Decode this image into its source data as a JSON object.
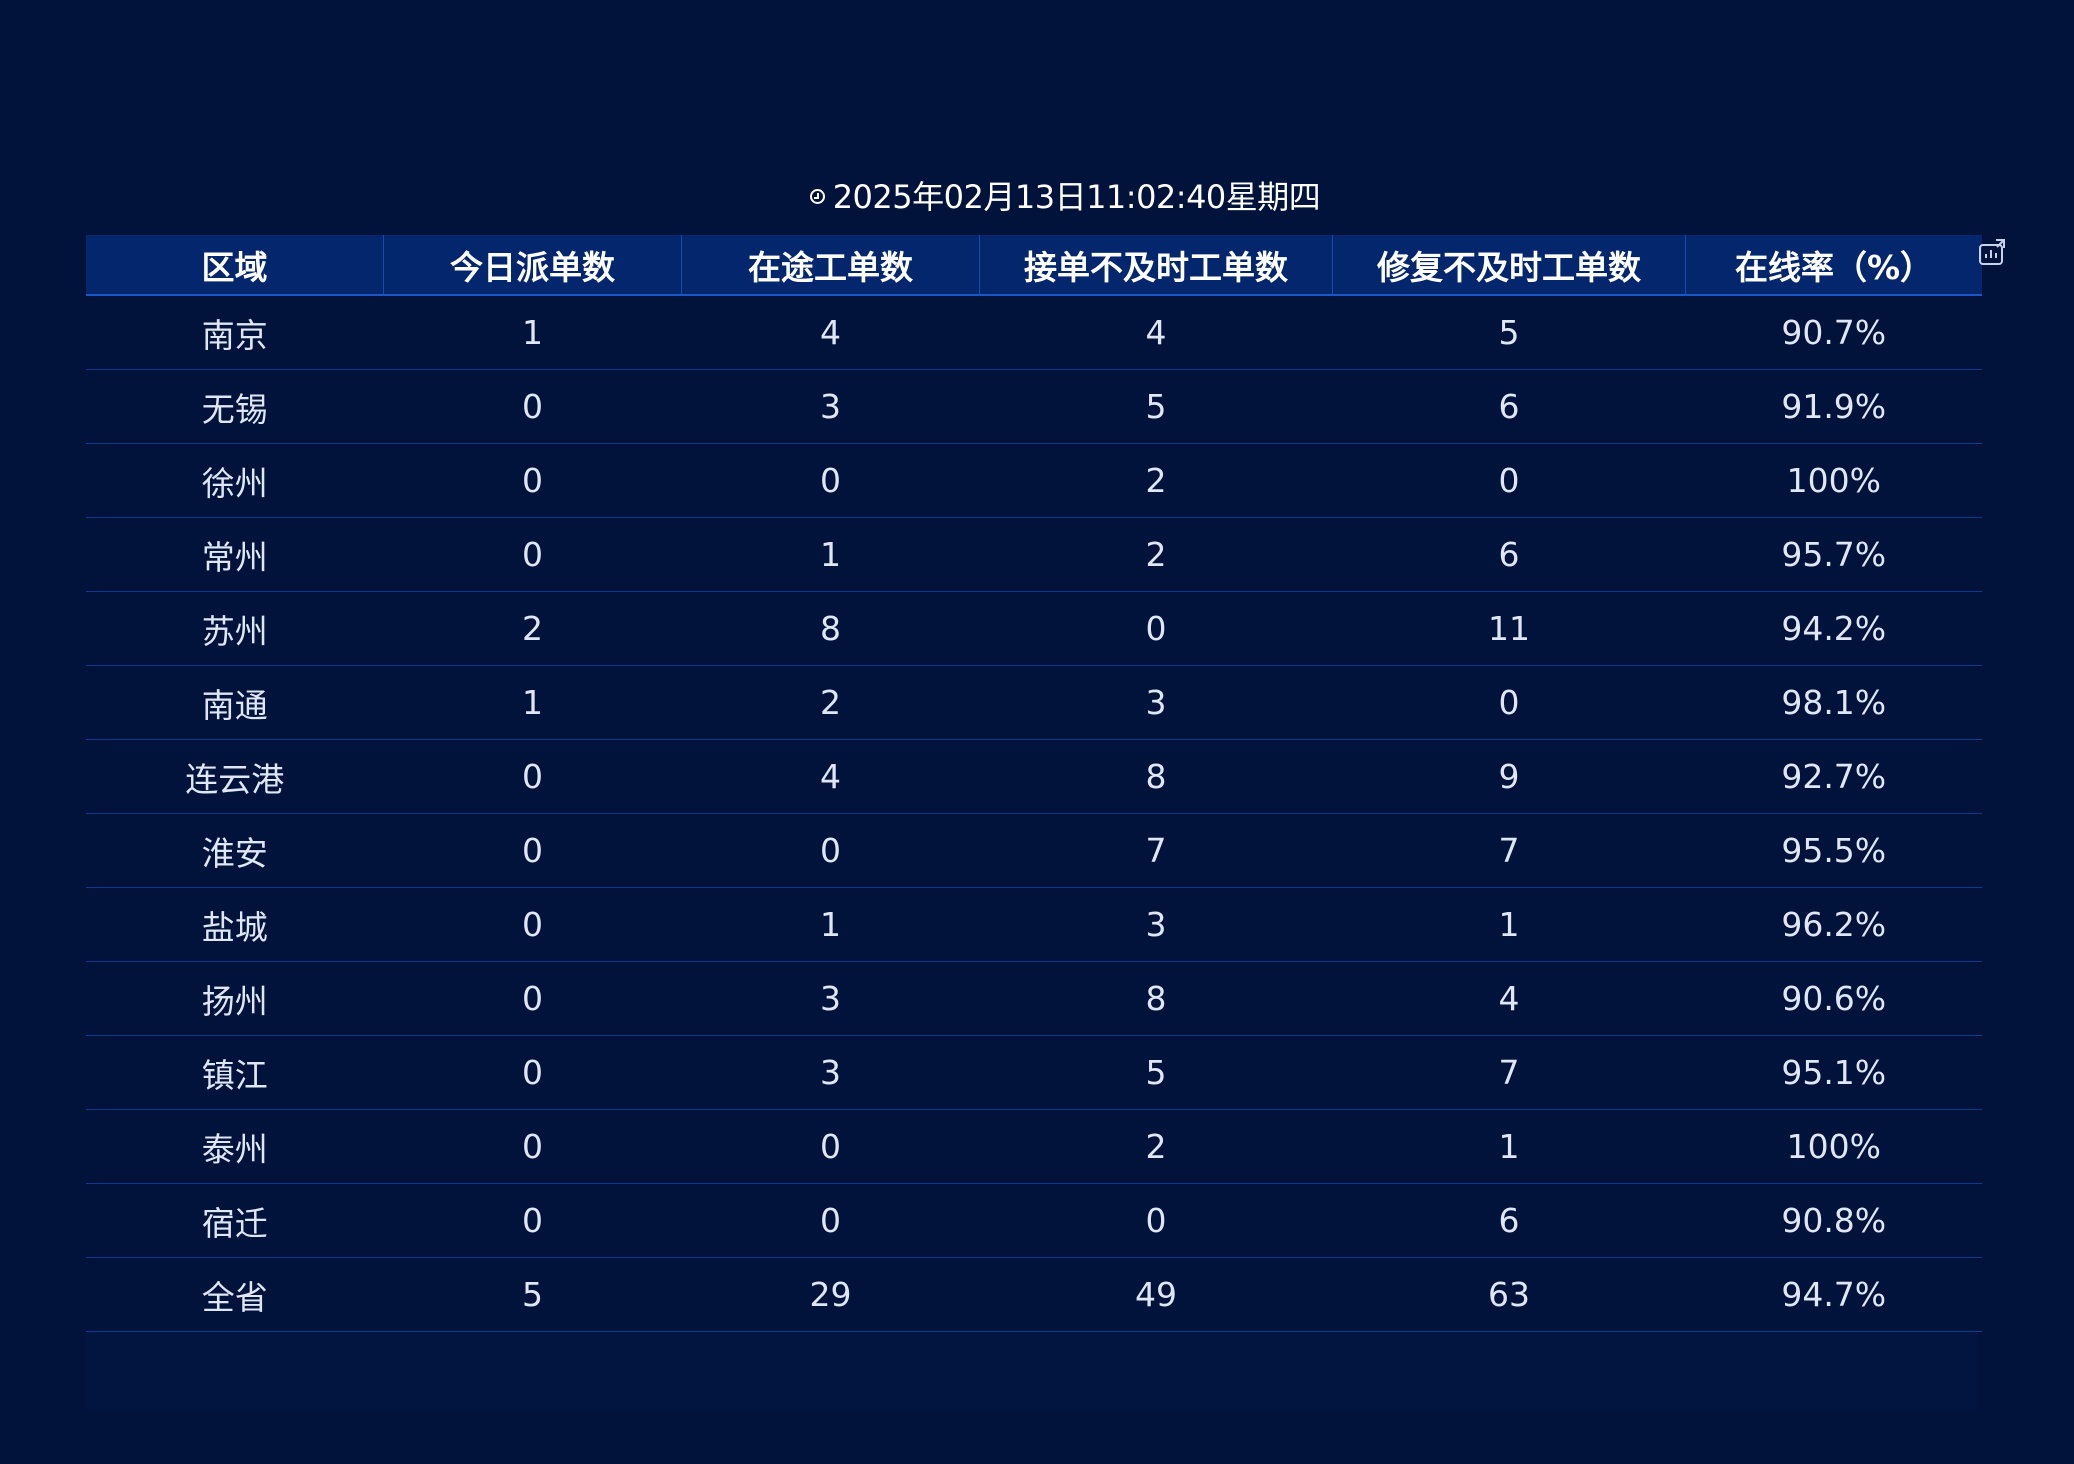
{
  "header": {
    "datetime": "2025年02月13日11:02:40星期四",
    "clock_icon": "clock-icon",
    "export_icon": "chart-export-icon"
  },
  "table": {
    "columns": [
      "区域",
      "今日派单数",
      "在途工单数",
      "接单不及时工单数",
      "修复不及时工单数",
      "在线率（%）"
    ],
    "rows": [
      [
        "南京",
        "1",
        "4",
        "4",
        "5",
        "90.7%"
      ],
      [
        "无锡",
        "0",
        "3",
        "5",
        "6",
        "91.9%"
      ],
      [
        "徐州",
        "0",
        "0",
        "2",
        "0",
        "100%"
      ],
      [
        "常州",
        "0",
        "1",
        "2",
        "6",
        "95.7%"
      ],
      [
        "苏州",
        "2",
        "8",
        "0",
        "11",
        "94.2%"
      ],
      [
        "南通",
        "1",
        "2",
        "3",
        "0",
        "98.1%"
      ],
      [
        "连云港",
        "0",
        "4",
        "8",
        "9",
        "92.7%"
      ],
      [
        "淮安",
        "0",
        "0",
        "7",
        "7",
        "95.5%"
      ],
      [
        "盐城",
        "0",
        "1",
        "3",
        "1",
        "96.2%"
      ],
      [
        "扬州",
        "0",
        "3",
        "8",
        "4",
        "90.6%"
      ],
      [
        "镇江",
        "0",
        "3",
        "5",
        "7",
        "95.1%"
      ],
      [
        "泰州",
        "0",
        "0",
        "2",
        "1",
        "100%"
      ],
      [
        "宿迁",
        "0",
        "0",
        "0",
        "6",
        "90.8%"
      ],
      [
        "全省",
        "5",
        "29",
        "49",
        "63",
        "94.7%"
      ]
    ]
  },
  "colors": {
    "page_background": "#01133a",
    "header_background": "#03266d",
    "row_divider": "#0f3a8c",
    "text": "#dfe6f5"
  }
}
